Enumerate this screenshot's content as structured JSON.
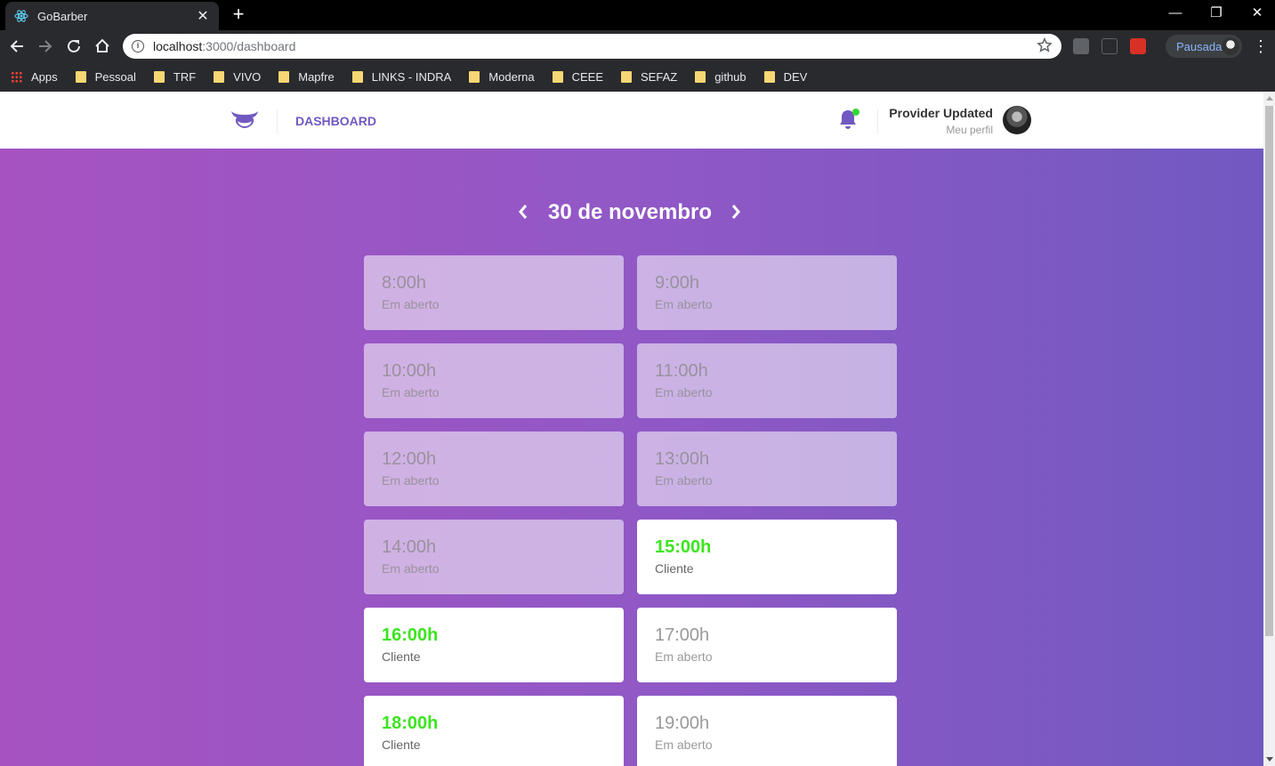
{
  "browser": {
    "tab_title": "GoBarber",
    "url_host": "localhost",
    "url_path": ":3000/dashboard",
    "profile_label": "Pausada",
    "bookmarks": [
      "Apps",
      "Pessoal",
      "TRF",
      "VIVO",
      "Mapfre",
      "LINKS - INDRA",
      "Moderna",
      "CEEE",
      "SEFAZ",
      "github",
      "DEV"
    ]
  },
  "header": {
    "nav_label": "DASHBOARD",
    "user_name": "Provider Updated",
    "profile_link": "Meu perfil",
    "notification_dot_color": "#32d932"
  },
  "schedule": {
    "date": "30 de novembro",
    "slots": [
      {
        "time": "8:00h",
        "label": "Em aberto",
        "status": "past"
      },
      {
        "time": "9:00h",
        "label": "Em aberto",
        "status": "past"
      },
      {
        "time": "10:00h",
        "label": "Em aberto",
        "status": "past"
      },
      {
        "time": "11:00h",
        "label": "Em aberto",
        "status": "past"
      },
      {
        "time": "12:00h",
        "label": "Em aberto",
        "status": "past"
      },
      {
        "time": "13:00h",
        "label": "Em aberto",
        "status": "past"
      },
      {
        "time": "14:00h",
        "label": "Em aberto",
        "status": "past"
      },
      {
        "time": "15:00h",
        "label": "Cliente",
        "status": "booked"
      },
      {
        "time": "16:00h",
        "label": "Cliente",
        "status": "booked"
      },
      {
        "time": "17:00h",
        "label": "Em aberto",
        "status": "available"
      },
      {
        "time": "18:00h",
        "label": "Cliente",
        "status": "booked"
      },
      {
        "time": "19:00h",
        "label": "Em aberto",
        "status": "available"
      }
    ]
  },
  "colors": {
    "brand": "#7159c1",
    "booked_time": "#3ce41f",
    "gradient_start": "#a653c1",
    "gradient_end": "#7159c1"
  }
}
